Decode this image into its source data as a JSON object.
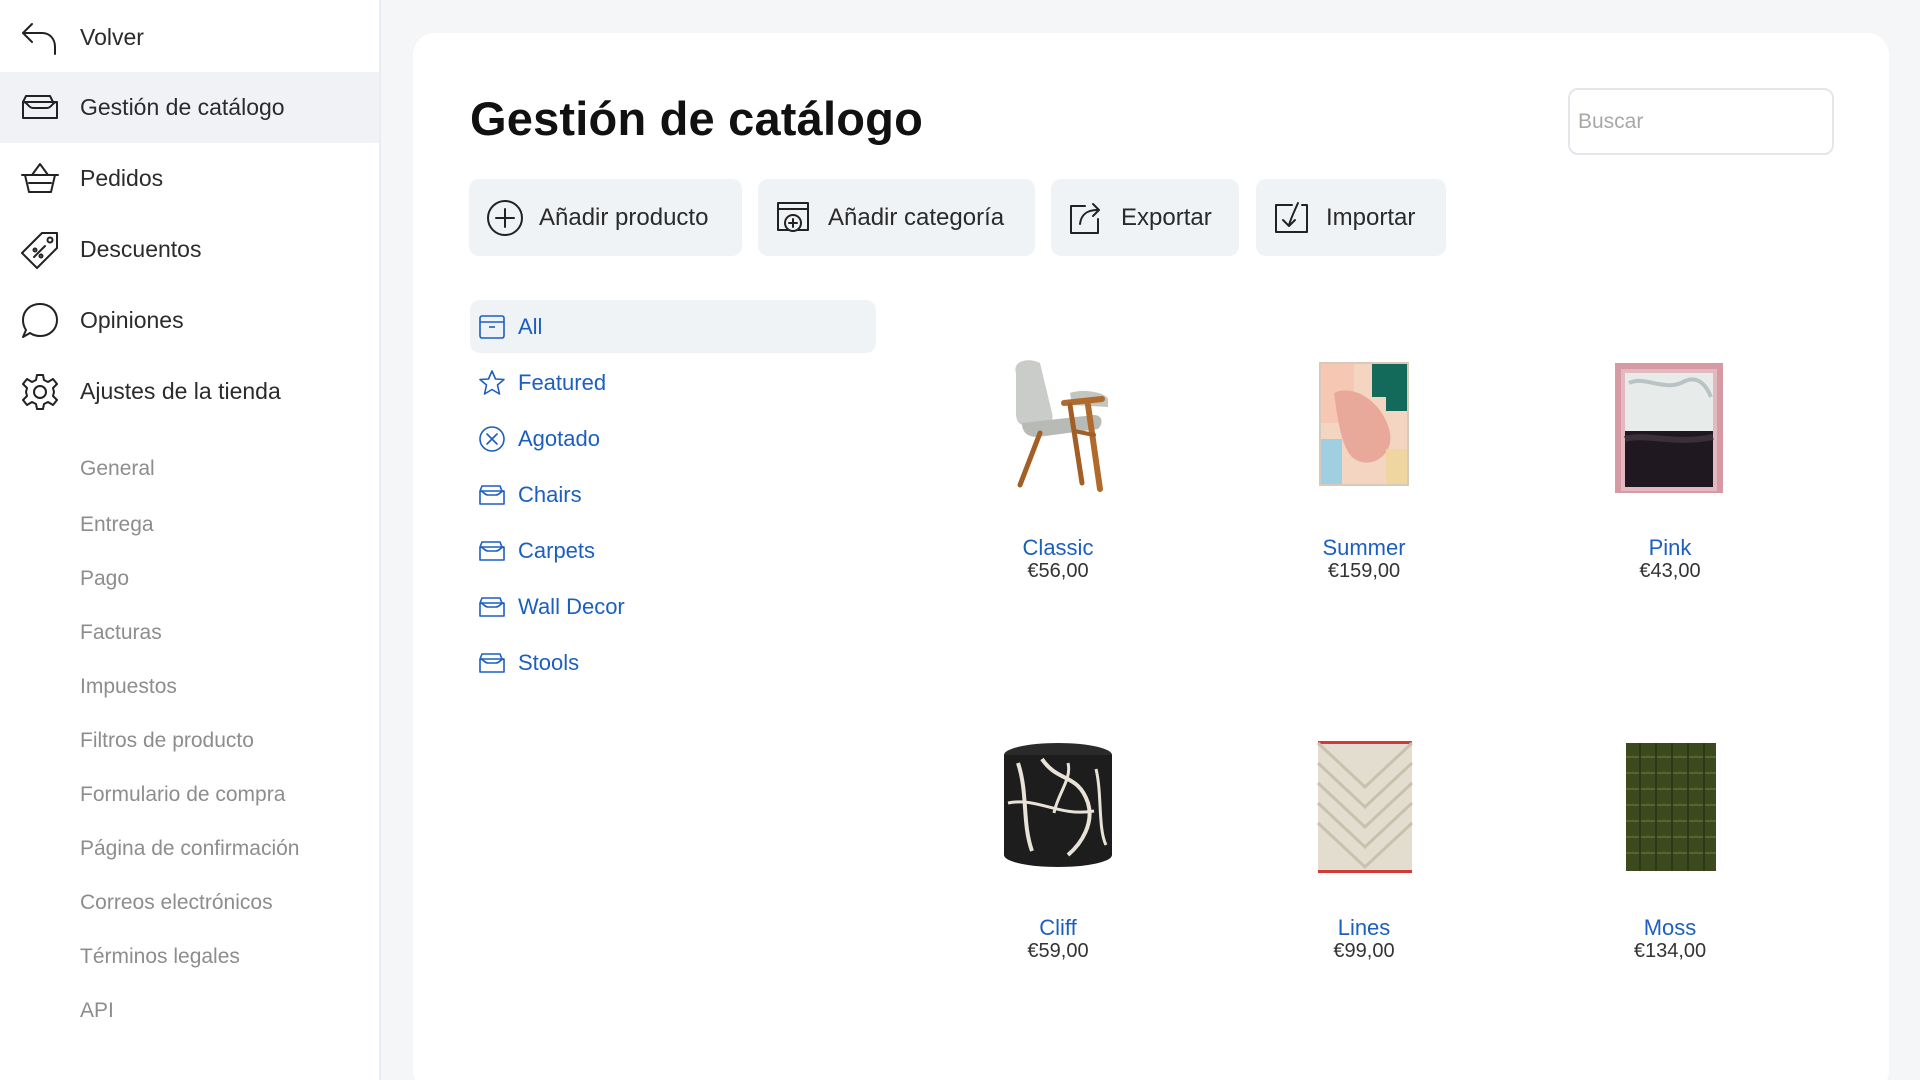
{
  "sidebar": {
    "back_label": "Volver",
    "items": [
      {
        "label": "Gestión de catálogo",
        "icon": "catalog-tray-icon"
      },
      {
        "label": "Pedidos",
        "icon": "basket-icon"
      },
      {
        "label": "Descuentos",
        "icon": "price-tag-icon"
      },
      {
        "label": "Opiniones",
        "icon": "speech-bubble-icon"
      },
      {
        "label": "Ajustes de la tienda",
        "icon": "gear-icon"
      }
    ],
    "sub_items": [
      "General",
      "Entrega",
      "Pago",
      "Facturas",
      "Impuestos",
      "Filtros de producto",
      "Formulario de compra",
      "Página de confirmación",
      "Correos electrónicos",
      "Términos legales",
      "API"
    ]
  },
  "main": {
    "title": "Gestión de catálogo",
    "search": {
      "placeholder": "Buscar",
      "value": ""
    },
    "toolbar": {
      "add_product": "Añadir producto",
      "add_category": "Añadir categoría",
      "export": "Exportar",
      "import": "Importar"
    },
    "categories": [
      {
        "label": "All",
        "icon": "archive-box-icon"
      },
      {
        "label": "Featured",
        "icon": "star-icon"
      },
      {
        "label": "Agotado",
        "icon": "circle-x-icon"
      },
      {
        "label": "Chairs",
        "icon": "category-tray-icon"
      },
      {
        "label": "Carpets",
        "icon": "category-tray-icon"
      },
      {
        "label": "Wall Decor",
        "icon": "category-tray-icon"
      },
      {
        "label": "Stools",
        "icon": "category-tray-icon"
      }
    ],
    "products": [
      {
        "name": "Classic",
        "price": "€56,00",
        "image": "armchair"
      },
      {
        "name": "Summer",
        "price": "€159,00",
        "image": "abstract-blanket"
      },
      {
        "name": "Pink",
        "price": "€43,00",
        "image": "abstract-painting"
      },
      {
        "name": "Cliff",
        "price": "€59,00",
        "image": "patterned-pouf"
      },
      {
        "name": "Lines",
        "price": "€99,00",
        "image": "striped-rug"
      },
      {
        "name": "Moss",
        "price": "€134,00",
        "image": "green-rug"
      }
    ]
  },
  "colors": {
    "link": "#1c5fc0",
    "active_bg": "#f0f3f6",
    "sidebar_bg": "#ffffff",
    "page_bg": "#f5f6f8"
  }
}
